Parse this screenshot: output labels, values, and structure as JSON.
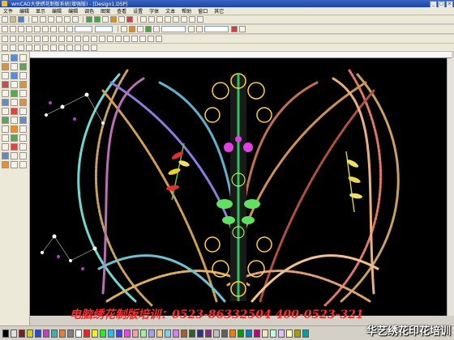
{
  "window": {
    "title": "wmCAD大使绣花制版系统(增强版) - [Design1.DSP]",
    "controls": [
      "_",
      "□",
      "×"
    ]
  },
  "menu": [
    "文件",
    "编辑",
    "显示",
    "编辑",
    "编辑",
    "调色",
    "图案",
    "查看",
    "设置",
    "字体",
    "文本",
    "帮助",
    "窗口",
    "其它"
  ],
  "canvas": {
    "bg": "#000000"
  },
  "promo_text": "电脑绣花制版培训：0523-86332504 400-0523-321",
  "watermark": "华艺绣花印花培训",
  "palette": [
    "#000000",
    "#e0e0e0",
    "#7a2020",
    "#d0d020",
    "#2050d0",
    "#c040c0",
    "#40b0b0",
    "#e08040",
    "#808080",
    "#ffffff",
    "#f02020",
    "#f0f020",
    "#20f020",
    "#20c0f0",
    "#4040f0",
    "#f040f0",
    "#f0a0a0",
    "#a0f0a0",
    "#a0a0f0",
    "#f0d080",
    "#80d0f0",
    "#d080f0",
    "#a06030",
    "#306030",
    "#303080",
    "#803080",
    "#c0c0c0",
    "#606060",
    "#f08000",
    "#00a000",
    "#0080c0",
    "#c00080",
    "#ffe0c0",
    "#c0ffe0",
    "#e0c0ff",
    "#ffffc0",
    "#a0a000",
    "#00a0a0"
  ],
  "colors": {
    "chrome": "#d4d0c8",
    "titlebar": "#1d44a8",
    "promo": "#ff2a2a"
  }
}
